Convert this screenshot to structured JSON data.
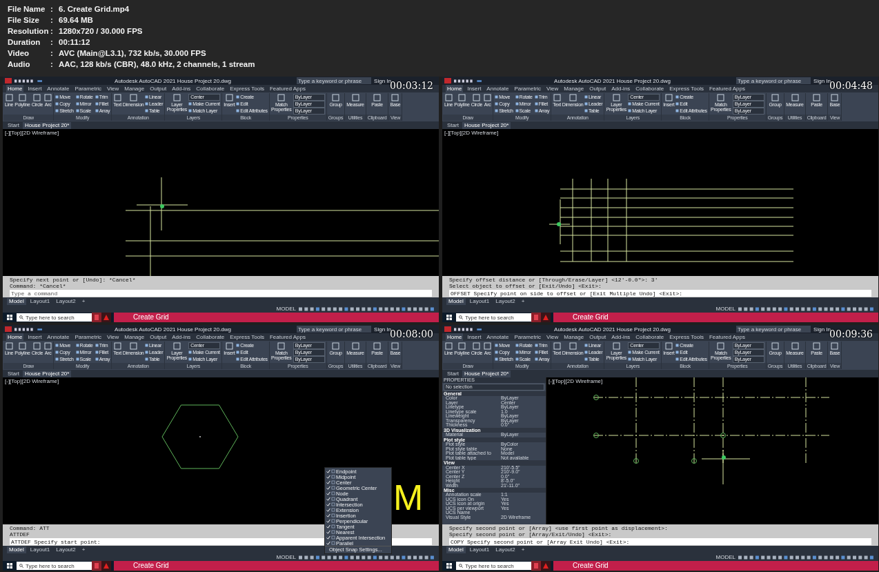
{
  "info": [
    {
      "label": "File Name",
      "separator": ":",
      "value": "6. Create Grid.mp4"
    },
    {
      "label": "File Size",
      "separator": ":",
      "value": "69.64 MB"
    },
    {
      "label": "Resolution",
      "separator": ":",
      "value": "1280x720 / 30.000 FPS"
    },
    {
      "label": "Duration",
      "separator": ":",
      "value": "00:11:12"
    },
    {
      "label": "Video",
      "separator": ":",
      "value": "AVC (Main@L3.1), 732 kb/s, 30.000 FPS"
    },
    {
      "label": "Audio",
      "separator": ":",
      "value": "AAC, 128 kb/s (CBR), 48.0 kHz, 2 channels, 1 stream"
    }
  ],
  "frames": [
    {
      "timestamp": "00:03:12",
      "kind": "lines",
      "app_title": "Autodesk AutoCAD 2021   House Project 20.dwg",
      "search_placeholder": "Type a keyword or phrase",
      "sign_in": "Sign In",
      "ribbon_tabs": [
        {
          "label": "Home",
          "selected": true
        },
        {
          "label": "Insert",
          "selected": false
        },
        {
          "label": "Annotate",
          "selected": false
        },
        {
          "label": "Parametric",
          "selected": false
        },
        {
          "label": "View",
          "selected": false
        },
        {
          "label": "Manage",
          "selected": false
        },
        {
          "label": "Output",
          "selected": false
        },
        {
          "label": "Add-ins",
          "selected": false
        },
        {
          "label": "Collaborate",
          "selected": false
        },
        {
          "label": "Express Tools",
          "selected": false
        },
        {
          "label": "Featured Apps",
          "selected": false
        }
      ],
      "ribbon_groups": [
        {
          "title": "Draw",
          "tools": [
            {
              "label": "Line",
              "kind": "large"
            },
            {
              "label": "Polyline",
              "kind": "large"
            },
            {
              "label": "Circle",
              "kind": "large"
            },
            {
              "label": "Arc",
              "kind": "large"
            }
          ]
        },
        {
          "title": "Modify",
          "tools": [
            {
              "label": "Move",
              "kind": "small"
            },
            {
              "label": "Copy",
              "kind": "small"
            },
            {
              "label": "Stretch",
              "kind": "small"
            },
            {
              "label": "Rotate",
              "kind": "small"
            },
            {
              "label": "Mirror",
              "kind": "small"
            },
            {
              "label": "Scale",
              "kind": "small"
            },
            {
              "label": "Trim",
              "kind": "small"
            },
            {
              "label": "Fillet",
              "kind": "small"
            },
            {
              "label": "Array",
              "kind": "small"
            }
          ]
        },
        {
          "title": "Annotation",
          "tools": [
            {
              "label": "Text",
              "kind": "large"
            },
            {
              "label": "Dimension",
              "kind": "large"
            },
            {
              "label": "Linear",
              "kind": "small"
            },
            {
              "label": "Leader",
              "kind": "small"
            },
            {
              "label": "Table",
              "kind": "small"
            }
          ]
        },
        {
          "title": "Layers",
          "tools": [
            {
              "label": "Layer Properties",
              "kind": "large"
            },
            {
              "label": "Center",
              "kind": "combo"
            },
            {
              "label": "Make Current",
              "kind": "small"
            },
            {
              "label": "Match Layer",
              "kind": "small"
            }
          ]
        },
        {
          "title": "Block",
          "tools": [
            {
              "label": "Insert",
              "kind": "large"
            },
            {
              "label": "Create",
              "kind": "small"
            },
            {
              "label": "Edit",
              "kind": "small"
            },
            {
              "label": "Edit Attributes",
              "kind": "small"
            }
          ]
        },
        {
          "title": "Properties",
          "tools": [
            {
              "label": "Match Properties",
              "kind": "large"
            },
            {
              "label": "ByLayer",
              "kind": "combo"
            },
            {
              "label": "ByLayer",
              "kind": "combo"
            },
            {
              "label": "ByLayer",
              "kind": "combo"
            }
          ]
        },
        {
          "title": "Groups",
          "tools": [
            {
              "label": "Group",
              "kind": "large"
            }
          ]
        },
        {
          "title": "Utilities",
          "tools": [
            {
              "label": "Measure",
              "kind": "large"
            }
          ]
        },
        {
          "title": "Clipboard",
          "tools": [
            {
              "label": "Paste",
              "kind": "large"
            }
          ]
        },
        {
          "title": "View",
          "tools": [
            {
              "label": "Base",
              "kind": "large"
            }
          ]
        }
      ],
      "doc_tabs": [
        {
          "label": "Start",
          "selected": false
        },
        {
          "label": "House Project 20*",
          "selected": true
        }
      ],
      "viewport_label": "[-][Top][2D Wireframe]",
      "command_history": [
        "Specify next point or [Undo]: *Cancel*",
        "Command: *Cancel*"
      ],
      "command_prompt": {
        "placeholder": "Type a command"
      },
      "layout_tabs": [
        {
          "label": "Model",
          "selected": true
        },
        {
          "label": "Layout1",
          "selected": false
        },
        {
          "label": "Layout2",
          "selected": false
        },
        {
          "label": "+",
          "selected": false
        }
      ],
      "status_mode": "MODEL",
      "taskbar_search": "Type here to search",
      "taskbar_title": "Create Grid"
    },
    {
      "timestamp": "00:04:48",
      "kind": "grid",
      "app_title": "Autodesk AutoCAD 2021   House Project 20.dwg",
      "search_placeholder": "Type a keyword or phrase",
      "sign_in": "Sign In",
      "ribbon_tabs": [
        {
          "label": "Home",
          "selected": true
        },
        {
          "label": "Insert",
          "selected": false
        },
        {
          "label": "Annotate",
          "selected": false
        },
        {
          "label": "Parametric",
          "selected": false
        },
        {
          "label": "View",
          "selected": false
        },
        {
          "label": "Manage",
          "selected": false
        },
        {
          "label": "Output",
          "selected": false
        },
        {
          "label": "Add-ins",
          "selected": false
        },
        {
          "label": "Collaborate",
          "selected": false
        },
        {
          "label": "Express Tools",
          "selected": false
        },
        {
          "label": "Featured Apps",
          "selected": false
        }
      ],
      "ribbon_groups": [
        {
          "title": "Draw",
          "tools": [
            {
              "label": "Line",
              "kind": "large"
            },
            {
              "label": "Polyline",
              "kind": "large"
            },
            {
              "label": "Circle",
              "kind": "large"
            },
            {
              "label": "Arc",
              "kind": "large"
            }
          ]
        },
        {
          "title": "Modify",
          "tools": [
            {
              "label": "Move",
              "kind": "small"
            },
            {
              "label": "Copy",
              "kind": "small"
            },
            {
              "label": "Stretch",
              "kind": "small"
            },
            {
              "label": "Rotate",
              "kind": "small"
            },
            {
              "label": "Mirror",
              "kind": "small"
            },
            {
              "label": "Scale",
              "kind": "small"
            },
            {
              "label": "Trim",
              "kind": "small"
            },
            {
              "label": "Fillet",
              "kind": "small"
            },
            {
              "label": "Array",
              "kind": "small"
            }
          ]
        },
        {
          "title": "Annotation",
          "tools": [
            {
              "label": "Text",
              "kind": "large"
            },
            {
              "label": "Dimension",
              "kind": "large"
            },
            {
              "label": "Linear",
              "kind": "small"
            },
            {
              "label": "Leader",
              "kind": "small"
            },
            {
              "label": "Table",
              "kind": "small"
            }
          ]
        },
        {
          "title": "Layers",
          "tools": [
            {
              "label": "Layer Properties",
              "kind": "large"
            },
            {
              "label": "Center",
              "kind": "combo"
            },
            {
              "label": "Make Current",
              "kind": "small"
            },
            {
              "label": "Match Layer",
              "kind": "small"
            }
          ]
        },
        {
          "title": "Block",
          "tools": [
            {
              "label": "Insert",
              "kind": "large"
            },
            {
              "label": "Create",
              "kind": "small"
            },
            {
              "label": "Edit",
              "kind": "small"
            },
            {
              "label": "Edit Attributes",
              "kind": "small"
            }
          ]
        },
        {
          "title": "Properties",
          "tools": [
            {
              "label": "Match Properties",
              "kind": "large"
            },
            {
              "label": "ByLayer",
              "kind": "combo"
            },
            {
              "label": "ByLayer",
              "kind": "combo"
            },
            {
              "label": "ByLayer",
              "kind": "combo"
            }
          ]
        },
        {
          "title": "Groups",
          "tools": [
            {
              "label": "Group",
              "kind": "large"
            }
          ]
        },
        {
          "title": "Utilities",
          "tools": [
            {
              "label": "Measure",
              "kind": "large"
            }
          ]
        },
        {
          "title": "Clipboard",
          "tools": [
            {
              "label": "Paste",
              "kind": "large"
            }
          ]
        },
        {
          "title": "View",
          "tools": [
            {
              "label": "Base",
              "kind": "large"
            }
          ]
        }
      ],
      "doc_tabs": [
        {
          "label": "Start",
          "selected": false
        },
        {
          "label": "House Project 20*",
          "selected": true
        }
      ],
      "viewport_label": "[-][Top][2D Wireframe]",
      "command_history": [
        "Specify offset distance or [Through/Erase/Layer] <12'-0.0\">: 3'",
        "Select object to offset or [Exit/Undo] <Exit>:"
      ],
      "command_prompt": {
        "value": "OFFSET Specify point on side to offset or [Exit Multiple Undo] <Exit>:"
      },
      "layout_tabs": [
        {
          "label": "Model",
          "selected": true
        },
        {
          "label": "Layout1",
          "selected": false
        },
        {
          "label": "Layout2",
          "selected": false
        },
        {
          "label": "+",
          "selected": false
        }
      ],
      "status_mode": "MODEL",
      "taskbar_search": "Type here to search",
      "taskbar_title": "Create Grid"
    },
    {
      "timestamp": "00:08:00",
      "kind": "hexagon",
      "app_title": "Autodesk AutoCAD 2021   House Project 20.dwg",
      "search_placeholder": "Type a keyword or phrase",
      "sign_in": "Sign In",
      "ribbon_tabs": [
        {
          "label": "Home",
          "selected": true
        },
        {
          "label": "Insert",
          "selected": false
        },
        {
          "label": "Annotate",
          "selected": false
        },
        {
          "label": "Parametric",
          "selected": false
        },
        {
          "label": "View",
          "selected": false
        },
        {
          "label": "Manage",
          "selected": false
        },
        {
          "label": "Output",
          "selected": false
        },
        {
          "label": "Add-ins",
          "selected": false
        },
        {
          "label": "Collaborate",
          "selected": false
        },
        {
          "label": "Express Tools",
          "selected": false
        },
        {
          "label": "Featured Apps",
          "selected": false
        }
      ],
      "ribbon_groups": [
        {
          "title": "Draw",
          "tools": [
            {
              "label": "Line",
              "kind": "large"
            },
            {
              "label": "Polyline",
              "kind": "large"
            },
            {
              "label": "Circle",
              "kind": "large"
            },
            {
              "label": "Arc",
              "kind": "large"
            }
          ]
        },
        {
          "title": "Modify",
          "tools": [
            {
              "label": "Move",
              "kind": "small"
            },
            {
              "label": "Copy",
              "kind": "small"
            },
            {
              "label": "Stretch",
              "kind": "small"
            },
            {
              "label": "Rotate",
              "kind": "small"
            },
            {
              "label": "Mirror",
              "kind": "small"
            },
            {
              "label": "Scale",
              "kind": "small"
            },
            {
              "label": "Trim",
              "kind": "small"
            },
            {
              "label": "Fillet",
              "kind": "small"
            },
            {
              "label": "Array",
              "kind": "small"
            }
          ]
        },
        {
          "title": "Annotation",
          "tools": [
            {
              "label": "Text",
              "kind": "large"
            },
            {
              "label": "Dimension",
              "kind": "large"
            },
            {
              "label": "Linear",
              "kind": "small"
            },
            {
              "label": "Leader",
              "kind": "small"
            },
            {
              "label": "Table",
              "kind": "small"
            }
          ]
        },
        {
          "title": "Layers",
          "tools": [
            {
              "label": "Layer Properties",
              "kind": "large"
            },
            {
              "label": "Center",
              "kind": "combo"
            },
            {
              "label": "Make Current",
              "kind": "small"
            },
            {
              "label": "Match Layer",
              "kind": "small"
            }
          ]
        },
        {
          "title": "Block",
          "tools": [
            {
              "label": "Insert",
              "kind": "large"
            },
            {
              "label": "Create",
              "kind": "small"
            },
            {
              "label": "Edit",
              "kind": "small"
            },
            {
              "label": "Edit Attributes",
              "kind": "small"
            }
          ]
        },
        {
          "title": "Properties",
          "tools": [
            {
              "label": "Match Properties",
              "kind": "large"
            },
            {
              "label": "ByLayer",
              "kind": "combo"
            },
            {
              "label": "ByLayer",
              "kind": "combo"
            },
            {
              "label": "ByLayer",
              "kind": "combo"
            }
          ]
        },
        {
          "title": "Groups",
          "tools": [
            {
              "label": "Group",
              "kind": "large"
            }
          ]
        },
        {
          "title": "Utilities",
          "tools": [
            {
              "label": "Measure",
              "kind": "large"
            }
          ]
        },
        {
          "title": "Clipboard",
          "tools": [
            {
              "label": "Paste",
              "kind": "large"
            }
          ]
        },
        {
          "title": "View",
          "tools": [
            {
              "label": "Base",
              "kind": "large"
            }
          ]
        }
      ],
      "doc_tabs": [
        {
          "label": "Start",
          "selected": false
        },
        {
          "label": "House Project 20*",
          "selected": true
        }
      ],
      "viewport_label": "[-][Top][2D Wireframe]",
      "drawing_text": "M",
      "command_history": [
        "Command: ATT",
        "ATTDEF"
      ],
      "command_prompt": {
        "value": "ATTDEF Specify start point:"
      },
      "osnap_menu": {
        "items": [
          {
            "label": "Endpoint",
            "checked": true
          },
          {
            "label": "Midpoint",
            "checked": true
          },
          {
            "label": "Center",
            "checked": true
          },
          {
            "label": "Geometric Center",
            "checked": true
          },
          {
            "label": "Node",
            "checked": true
          },
          {
            "label": "Quadrant",
            "checked": true
          },
          {
            "label": "Intersection",
            "checked": true
          },
          {
            "label": "Extension",
            "checked": true
          },
          {
            "label": "Insertion",
            "checked": true
          },
          {
            "label": "Perpendicular",
            "checked": true
          },
          {
            "label": "Tangent",
            "checked": true
          },
          {
            "label": "Nearest",
            "checked": true
          },
          {
            "label": "Apparent Intersection",
            "checked": true
          },
          {
            "label": "Parallel",
            "checked": true
          }
        ],
        "settings": "Object Snap Settings..."
      },
      "layout_tabs": [
        {
          "label": "Model",
          "selected": true
        },
        {
          "label": "Layout1",
          "selected": false
        },
        {
          "label": "Layout2",
          "selected": false
        },
        {
          "label": "+",
          "selected": false
        }
      ],
      "status_mode": "MODEL",
      "taskbar_search": "Type here to search",
      "taskbar_title": "Create Grid"
    },
    {
      "timestamp": "00:09:36",
      "kind": "axes",
      "app_title": "Autodesk AutoCAD 2021   House Project 20.dwg",
      "search_placeholder": "Type a keyword or phrase",
      "sign_in": "Sign In",
      "ribbon_tabs": [
        {
          "label": "Home",
          "selected": true
        },
        {
          "label": "Insert",
          "selected": false
        },
        {
          "label": "Annotate",
          "selected": false
        },
        {
          "label": "Parametric",
          "selected": false
        },
        {
          "label": "View",
          "selected": false
        },
        {
          "label": "Manage",
          "selected": false
        },
        {
          "label": "Output",
          "selected": false
        },
        {
          "label": "Add-ins",
          "selected": false
        },
        {
          "label": "Collaborate",
          "selected": false
        },
        {
          "label": "Express Tools",
          "selected": false
        },
        {
          "label": "Featured Apps",
          "selected": false
        }
      ],
      "ribbon_groups": [
        {
          "title": "Draw",
          "tools": [
            {
              "label": "Line",
              "kind": "large"
            },
            {
              "label": "Polyline",
              "kind": "large"
            },
            {
              "label": "Circle",
              "kind": "large"
            },
            {
              "label": "Arc",
              "kind": "large"
            }
          ]
        },
        {
          "title": "Modify",
          "tools": [
            {
              "label": "Move",
              "kind": "small"
            },
            {
              "label": "Copy",
              "kind": "small"
            },
            {
              "label": "Stretch",
              "kind": "small"
            },
            {
              "label": "Rotate",
              "kind": "small"
            },
            {
              "label": "Mirror",
              "kind": "small"
            },
            {
              "label": "Scale",
              "kind": "small"
            },
            {
              "label": "Trim",
              "kind": "small"
            },
            {
              "label": "Fillet",
              "kind": "small"
            },
            {
              "label": "Array",
              "kind": "small"
            }
          ]
        },
        {
          "title": "Annotation",
          "tools": [
            {
              "label": "Text",
              "kind": "large"
            },
            {
              "label": "Dimension",
              "kind": "large"
            },
            {
              "label": "Linear",
              "kind": "small"
            },
            {
              "label": "Leader",
              "kind": "small"
            },
            {
              "label": "Table",
              "kind": "small"
            }
          ]
        },
        {
          "title": "Layers",
          "tools": [
            {
              "label": "Layer Properties",
              "kind": "large"
            },
            {
              "label": "Center",
              "kind": "combo"
            },
            {
              "label": "Make Current",
              "kind": "small"
            },
            {
              "label": "Match Layer",
              "kind": "small"
            }
          ]
        },
        {
          "title": "Block",
          "tools": [
            {
              "label": "Insert",
              "kind": "large"
            },
            {
              "label": "Create",
              "kind": "small"
            },
            {
              "label": "Edit",
              "kind": "small"
            },
            {
              "label": "Edit Attributes",
              "kind": "small"
            }
          ]
        },
        {
          "title": "Properties",
          "tools": [
            {
              "label": "Match Properties",
              "kind": "large"
            },
            {
              "label": "ByLayer",
              "kind": "combo"
            },
            {
              "label": "ByLayer",
              "kind": "combo"
            },
            {
              "label": "ByLayer",
              "kind": "combo"
            }
          ]
        },
        {
          "title": "Groups",
          "tools": [
            {
              "label": "Group",
              "kind": "large"
            }
          ]
        },
        {
          "title": "Utilities",
          "tools": [
            {
              "label": "Measure",
              "kind": "large"
            }
          ]
        },
        {
          "title": "Clipboard",
          "tools": [
            {
              "label": "Paste",
              "kind": "large"
            }
          ]
        },
        {
          "title": "View",
          "tools": [
            {
              "label": "Base",
              "kind": "large"
            }
          ]
        }
      ],
      "doc_tabs": [
        {
          "label": "Start",
          "selected": false
        },
        {
          "label": "House Project 20*",
          "selected": true
        }
      ],
      "viewport_label": "[-][Top][2D Wireframe]",
      "properties": {
        "title": "PROPERTIES",
        "selection": "No selection",
        "sections": [
          {
            "title": "General",
            "rows": [
              {
                "name": "Color",
                "value": "ByLayer"
              },
              {
                "name": "Layer",
                "value": "Center"
              },
              {
                "name": "Linetype",
                "value": "ByLayer"
              },
              {
                "name": "Linetype scale",
                "value": "1.0"
              },
              {
                "name": "Lineweight",
                "value": "ByLayer"
              },
              {
                "name": "Transparency",
                "value": "ByLayer"
              },
              {
                "name": "Thickness",
                "value": "0.0\""
              }
            ]
          },
          {
            "title": "3D Visualization",
            "rows": [
              {
                "name": "Material",
                "value": "ByLayer"
              }
            ]
          },
          {
            "title": "Plot style",
            "rows": [
              {
                "name": "Plot style",
                "value": "ByColor"
              },
              {
                "name": "Plot style table",
                "value": "None"
              },
              {
                "name": "Plot table attached to",
                "value": "Model"
              },
              {
                "name": "Plot table type",
                "value": "Not available"
              }
            ]
          },
          {
            "title": "View",
            "rows": [
              {
                "name": "Center X",
                "value": "210'-5.5\""
              },
              {
                "name": "Center Y",
                "value": "210'-9.0\""
              },
              {
                "name": "Center Z",
                "value": "0.0\""
              },
              {
                "name": "Height",
                "value": "8'-5.0\""
              },
              {
                "name": "Width",
                "value": "21'-11.0\""
              }
            ]
          },
          {
            "title": "Misc",
            "rows": [
              {
                "name": "Annotation scale",
                "value": "1:1"
              },
              {
                "name": "UCS icon On",
                "value": "Yes"
              },
              {
                "name": "UCS icon at origin",
                "value": "Yes"
              },
              {
                "name": "UCS per viewport",
                "value": "Yes"
              },
              {
                "name": "UCS Name"
              },
              {
                "name": "Visual Style",
                "value": "2D Wireframe"
              }
            ]
          }
        ]
      },
      "command_history": [
        "Specify second point or [Array] <use first point as displacement>:",
        "Specify second point or [Array/Exit/Undo] <Exit>:"
      ],
      "command_prompt": {
        "value": "COPY Specify second point or [Array Exit Undo] <Exit>:"
      },
      "layout_tabs": [
        {
          "label": "Model",
          "selected": true
        },
        {
          "label": "Layout1",
          "selected": false
        },
        {
          "label": "Layout2",
          "selected": false
        },
        {
          "label": "+",
          "selected": false
        }
      ],
      "status_mode": "MODEL",
      "taskbar_search": "Type here to search",
      "taskbar_title": "Create Grid"
    }
  ]
}
